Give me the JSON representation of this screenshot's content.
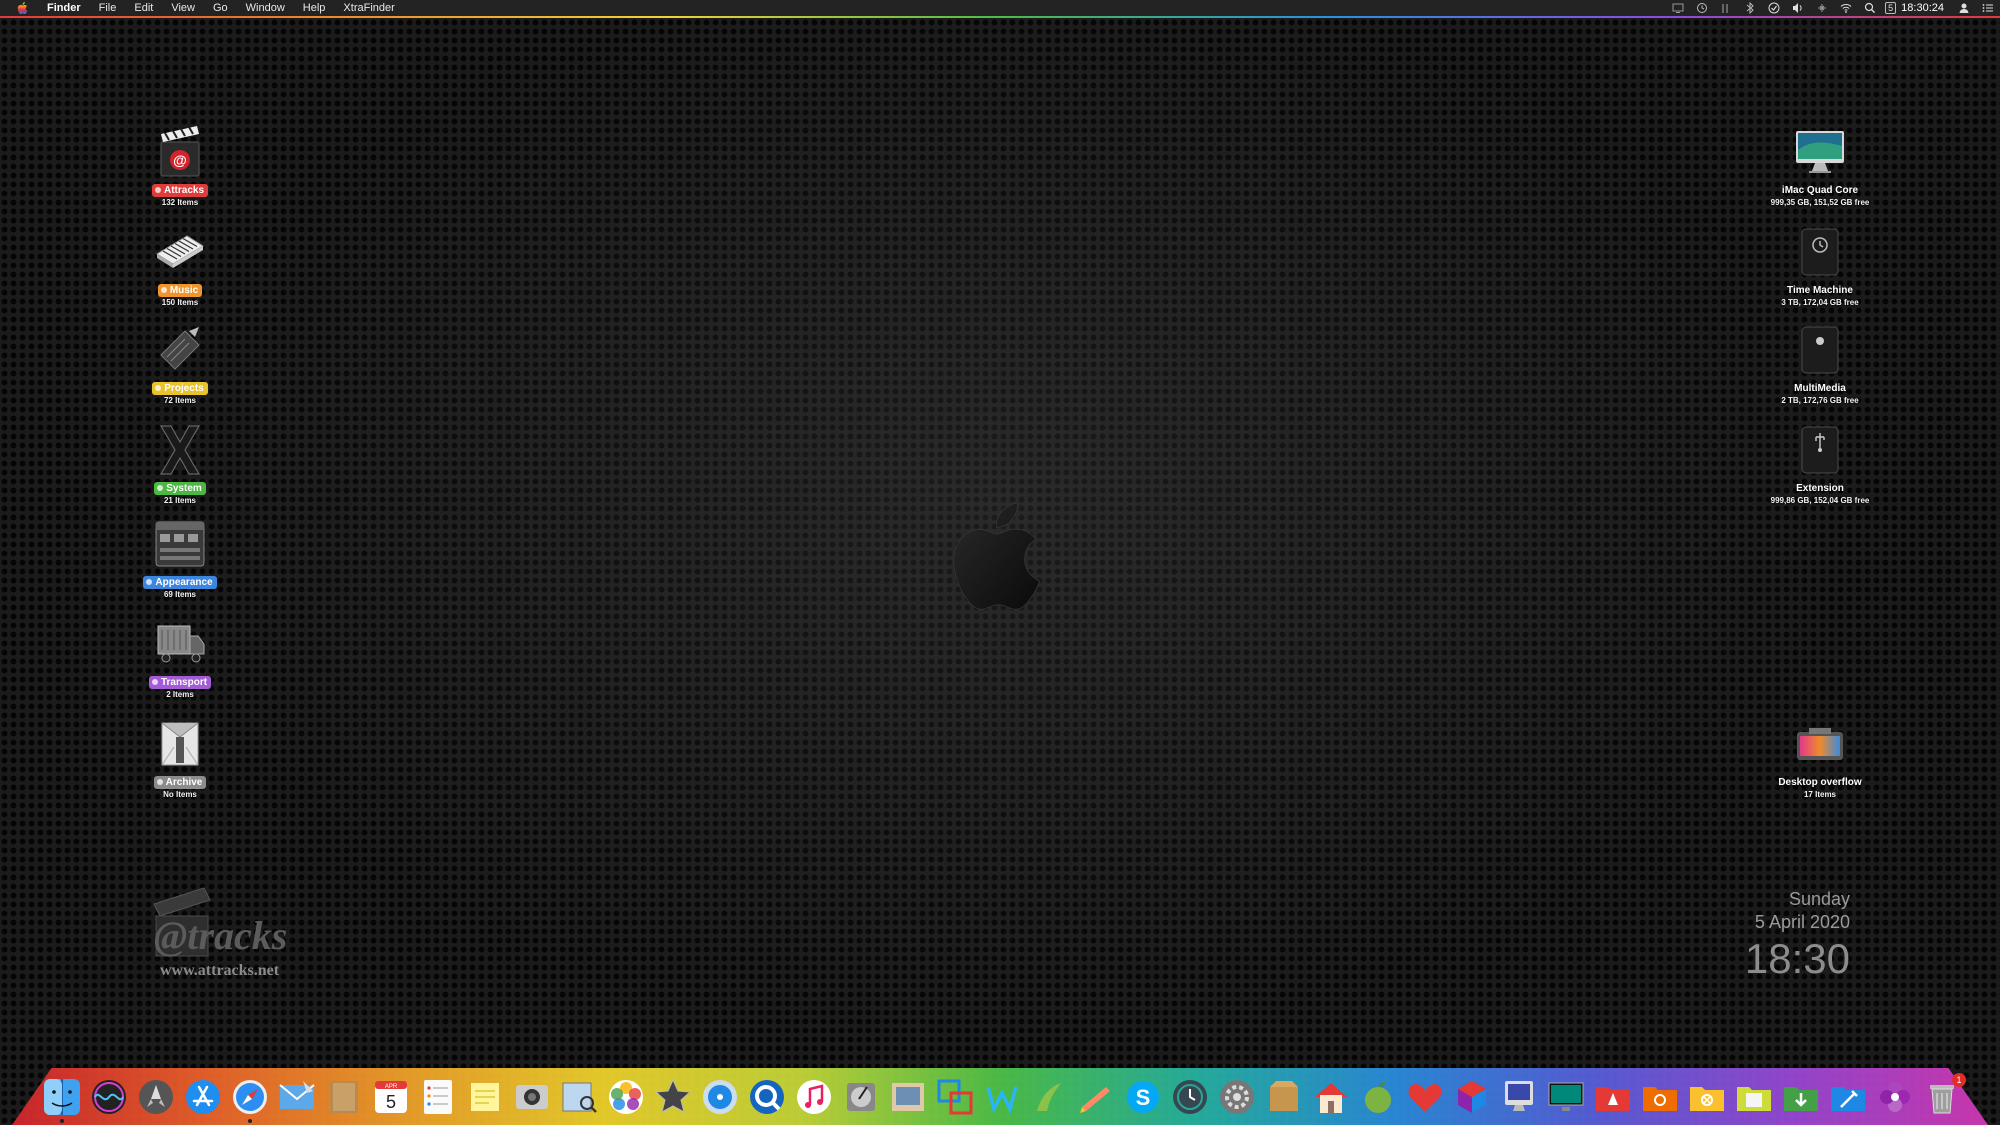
{
  "menubar": {
    "app_name": "Finder",
    "items": [
      "File",
      "Edit",
      "View",
      "Go",
      "Window",
      "Help",
      "XtraFinder"
    ],
    "status_icons": [
      "screen-icon",
      "time-machine-icon",
      "bars-icon",
      "bluetooth-icon",
      "check-icon",
      "volume-icon",
      "network-icon",
      "wifi-icon",
      "spotlight-icon"
    ],
    "calendar_badge": "5",
    "clock": "18:30:24",
    "right_icons": [
      "user-icon",
      "notification-list-icon"
    ]
  },
  "desktop_left": [
    {
      "name": "Attracks",
      "count": "132 Items",
      "tag_color": "#e03c3c"
    },
    {
      "name": "Music",
      "count": "150 Items",
      "tag_color": "#f0952e"
    },
    {
      "name": "Projects",
      "count": "72 Items",
      "tag_color": "#e8c32c"
    },
    {
      "name": "System",
      "count": "21 Items",
      "tag_color": "#4cb842"
    },
    {
      "name": "Appearance",
      "count": "69 Items",
      "tag_color": "#3d86e0"
    },
    {
      "name": "Transport",
      "count": "2 Items",
      "tag_color": "#a35bd6"
    },
    {
      "name": "Archive",
      "count": "No Items",
      "tag_color": "#8c8c8c"
    }
  ],
  "desktop_right": [
    {
      "name": "iMac Quad Core",
      "info": "999,35 GB, 151,52 GB free"
    },
    {
      "name": "Time Machine",
      "info": "3 TB, 172,04 GB free"
    },
    {
      "name": "MultiMedia",
      "info": "2 TB, 172,76 GB free"
    },
    {
      "name": "Extension",
      "info": "999,86 GB, 152,04 GB free"
    },
    {
      "name": "Desktop overflow",
      "info": "17 Items"
    }
  ],
  "watermark": {
    "logo_text": "@tracks",
    "url": "www.attracks.net"
  },
  "date_widget": {
    "day": "Sunday",
    "date": "5 April 2020",
    "time": "18:30"
  },
  "dock": {
    "items": [
      "finder-icon",
      "siri-icon",
      "launchpad-icon",
      "app-store-icon",
      "safari-icon",
      "mail-icon",
      "notes-book-icon",
      "calendar-icon",
      "reminders-icon",
      "stickies-icon",
      "screenshot-icon",
      "preview-icon",
      "photos-icon",
      "imovie-icon",
      "dvd-player-icon",
      "quicktime-icon",
      "itunes-icon",
      "disk-utility-icon",
      "image-capture-icon",
      "parallels-icon",
      "wunderlist-icon",
      "scrivener-icon",
      "pages-icon",
      "skype-icon",
      "time-machine-icon",
      "system-preferences-icon",
      "archive-utility-icon",
      "home-icon",
      "apple-fruit-icon",
      "heart-icon",
      "cube-icon",
      "imac-old-icon",
      "display-icon",
      "apps-folder-icon",
      "public-folder-icon",
      "utilities-folder-icon",
      "documents-folder-icon",
      "downloads-folder-icon",
      "tools-folder-icon",
      "flower-icon",
      "trash-icon"
    ],
    "calendar_day": "5",
    "calendar_month": "APR",
    "trash_badge": "1"
  },
  "colors": {
    "menubar_bg": "#232323",
    "desktop_bg": "#1b1b1b"
  }
}
